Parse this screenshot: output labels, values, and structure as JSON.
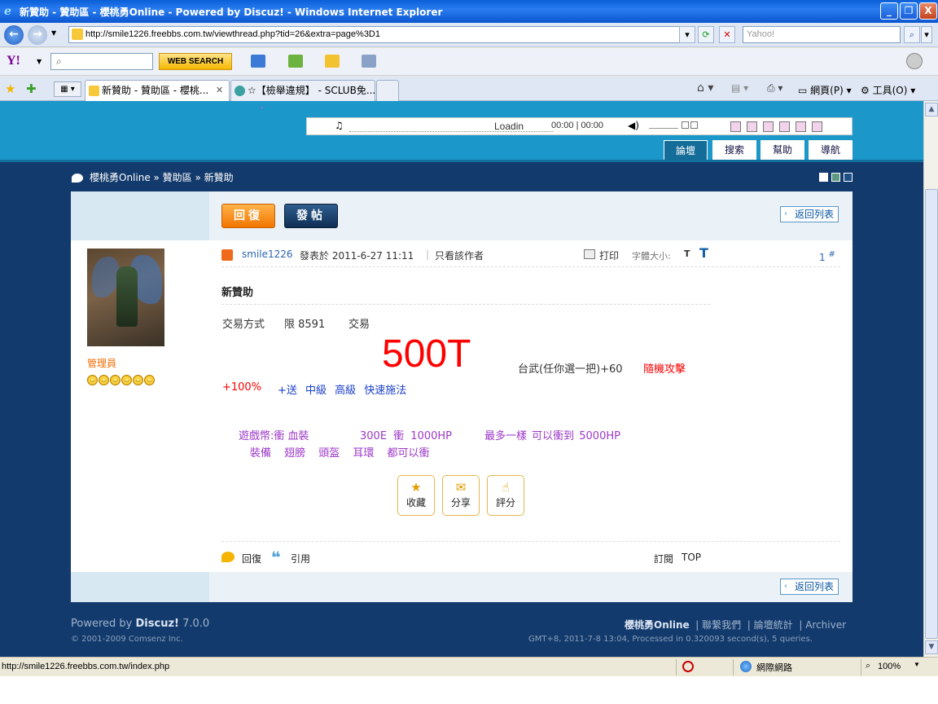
{
  "window": {
    "title": "新贊助 - 贊助區 - 櫻桃勇Online - Powered by Discuz! - Windows Internet Explorer",
    "minimize": "_",
    "maximize": "❐",
    "close": "X"
  },
  "address": {
    "url": "http://smile1226.freebbs.com.tw/viewthread.php?tid=26&extra=page%3D1",
    "search_placeholder": "Yahoo!"
  },
  "yahoo_toolbar": {
    "logo": "Y!",
    "search_button": "WEB SEARCH"
  },
  "tabs": [
    {
      "label": "新贊助 - 贊助區 - 櫻桃..."
    },
    {
      "label": "☆【檢舉違規】 - SCLUB免..."
    }
  ],
  "command_bar": {
    "page_menu": "網頁(P)",
    "tools_menu": "工具(O)"
  },
  "site": {
    "player_label": "Loadin",
    "player_time": "00:00 | 00:00",
    "nav": [
      "論壇",
      "搜索",
      "幫助",
      "導航"
    ],
    "breadcrumb": "櫻桃勇Online » 贊助區 » 新贊助"
  },
  "thread": {
    "reply_button": "回復",
    "post_button": "發帖",
    "back_to_list": "返回列表",
    "author": "smile1226",
    "posted_at": "發表於 2011-6-27 11:11",
    "only_author": "只看該作者",
    "print": "打印",
    "font_size_label": "字體大小:",
    "font_small": "T",
    "font_big": "T",
    "floor": "1",
    "floor_mark": "#",
    "user_role": "管理員",
    "title": "新贊助",
    "line1": [
      "交易方式",
      "限 8591",
      "交易"
    ],
    "price": "500T",
    "weapon": "台武(任你選一把)+60",
    "random_attack": "隨機攻擊",
    "bonus_red": "+100%",
    "bonus_blue": "+送 中級 高級 快速施法",
    "game_line1": "遊戲幣:衝 血裝",
    "game_line1b": "300E 衝 1000HP",
    "game_line1c": "最多一樣 可以衝到 5000HP",
    "game_line2": "裝備 翅膀 頭盔 耳環 都可以衝",
    "actions": [
      "收藏",
      "分享",
      "評分"
    ],
    "reply_link": "回復",
    "quote_link": "引用",
    "subscribe": "訂閱",
    "top": "TOP"
  },
  "footer": {
    "powered": "Powered by",
    "discuz": "Discuz!",
    "version": "7.0.0",
    "copyright": "© 2001-2009 Comsenz Inc.",
    "site_name": "櫻桃勇Online",
    "links": [
      "聯繫我們",
      "論壇統計",
      "Archiver"
    ],
    "gmt": "GMT+8, 2011-7-8 13:04, Processed in 0.320093 second(s), 5 queries."
  },
  "statusbar": {
    "url": "http://smile1226.freebbs.com.tw/index.php",
    "zone": "網際網路",
    "zoom": "100%"
  }
}
